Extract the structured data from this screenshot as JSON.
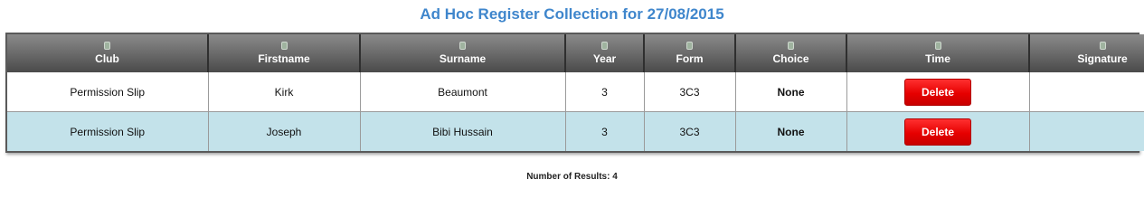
{
  "title": "Ad Hoc Register Collection for 27/08/2015",
  "columns": [
    "Club",
    "Firstname",
    "Surname",
    "Year",
    "Form",
    "Choice",
    "Time",
    "Signature"
  ],
  "sort_icon": "bin-icon",
  "rows": [
    {
      "club": "Permission Slip",
      "firstname": "Kirk",
      "surname": "Beaumont",
      "year": "3",
      "form": "3C3",
      "choice": "None",
      "time_action": "Delete",
      "signature": ""
    },
    {
      "club": "Permission Slip",
      "firstname": "Joseph",
      "surname": "Bibi Hussain",
      "year": "3",
      "form": "3C3",
      "choice": "None",
      "time_action": "Delete",
      "signature": ""
    }
  ],
  "results": {
    "label": "Number of Results: 4"
  },
  "colors": {
    "title": "#3f86cc",
    "row_alt": "#c3e2ea",
    "delete": "#e60000",
    "header": "#6e6e6e"
  }
}
